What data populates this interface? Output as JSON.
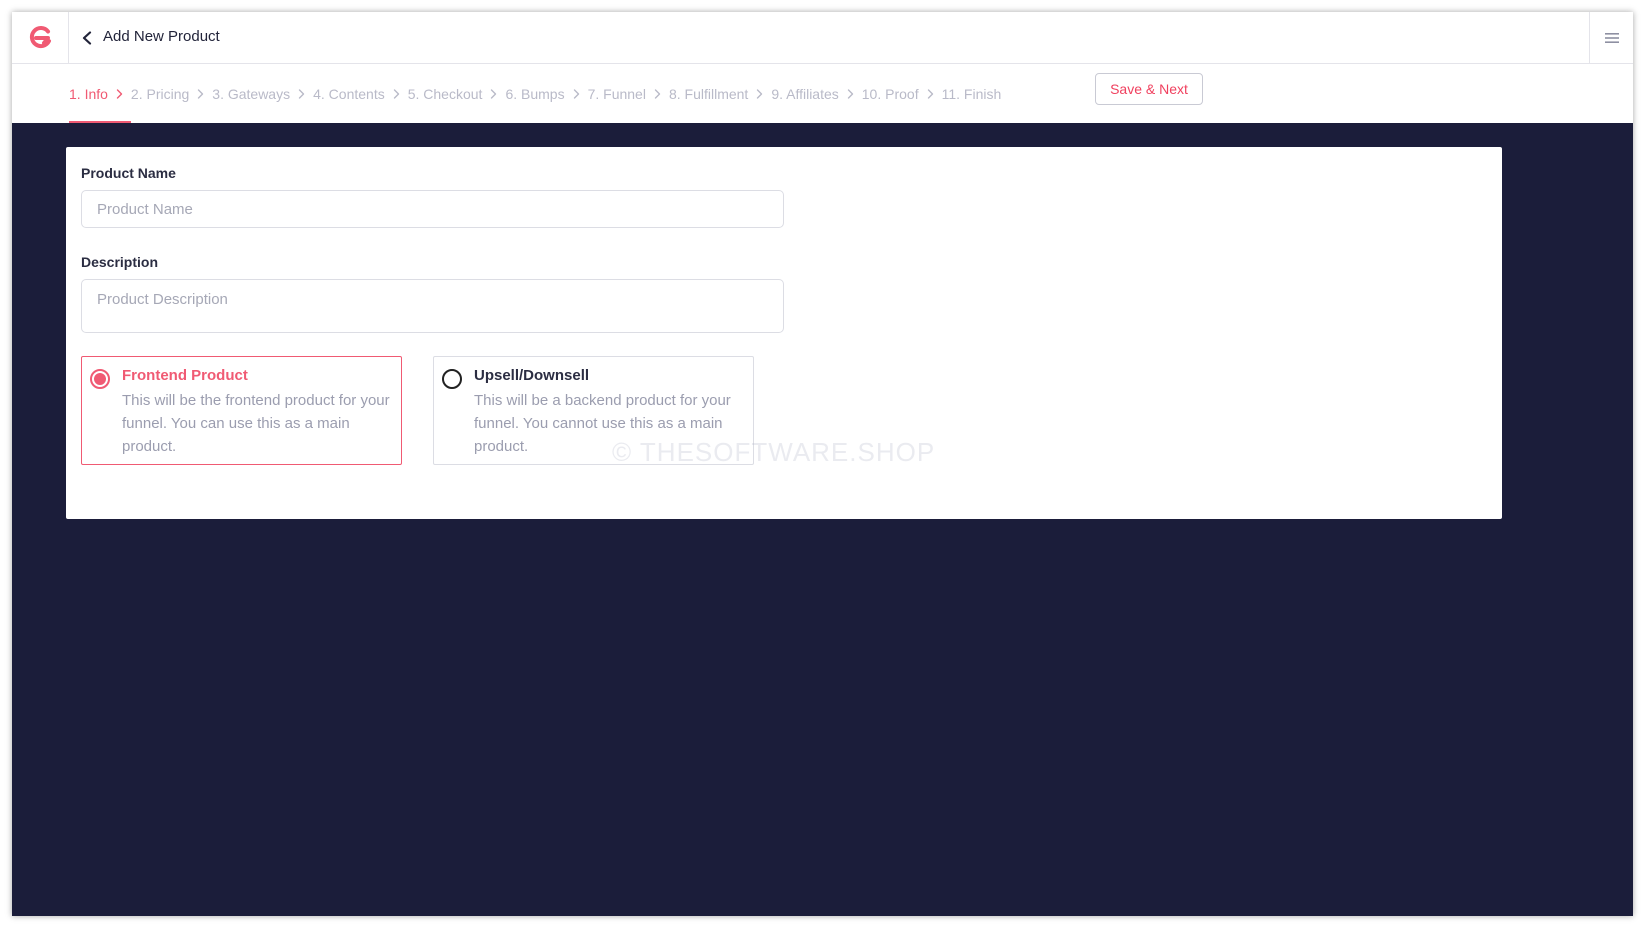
{
  "header": {
    "title": "Add New Product"
  },
  "steps": [
    {
      "label": "1. Info",
      "active": true
    },
    {
      "label": "2. Pricing",
      "active": false
    },
    {
      "label": "3. Gateways",
      "active": false
    },
    {
      "label": "4. Contents",
      "active": false
    },
    {
      "label": "5. Checkout",
      "active": false
    },
    {
      "label": "6. Bumps",
      "active": false
    },
    {
      "label": "7. Funnel",
      "active": false
    },
    {
      "label": "8. Fulfillment",
      "active": false
    },
    {
      "label": "9. Affiliates",
      "active": false
    },
    {
      "label": "10. Proof",
      "active": false
    },
    {
      "label": "11. Finish",
      "active": false
    }
  ],
  "toolbar": {
    "save_label": "Save & Next"
  },
  "form": {
    "product_name": {
      "label": "Product Name",
      "placeholder": "Product Name",
      "value": ""
    },
    "description": {
      "label": "Description",
      "placeholder": "Product Description",
      "value": ""
    },
    "options": [
      {
        "title": "Frontend Product",
        "description": "This will be the frontend product for your funnel. You can use this as a main product.",
        "selected": true
      },
      {
        "title": "Upsell/Downsell",
        "description": "This will be a backend product for your funnel. You cannot use this as a main product.",
        "selected": false
      }
    ]
  },
  "watermark": "© THESOFTWARE.SHOP",
  "colors": {
    "accent": "#f05a73",
    "background": "#1b1d3a",
    "muted_step": "#b9bac8"
  },
  "icons": {
    "logo": "brand-logo-icon",
    "back": "chevron-left-icon",
    "menu": "hamburger-menu-icon",
    "step_separator": "chevron-right-icon"
  }
}
